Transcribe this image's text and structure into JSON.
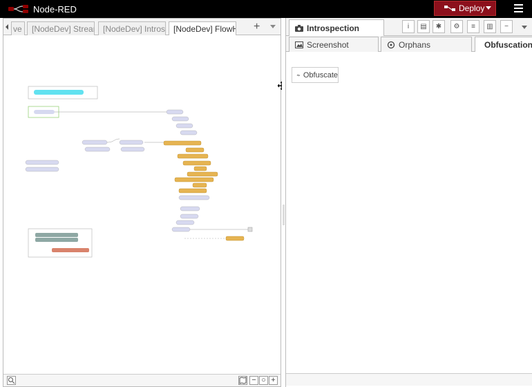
{
  "header": {
    "app_title": "Node-RED",
    "deploy_label": "Deploy",
    "colors": {
      "bar": "#000000",
      "deploy": "#8c101c"
    }
  },
  "workspace": {
    "tabs": [
      {
        "label": "ve"
      },
      {
        "label": "[NodeDev] Streamli"
      },
      {
        "label": "[NodeDev] Introspe"
      },
      {
        "label": "[NodeDev] FlowHu"
      }
    ],
    "add_label": "+",
    "footer": {
      "zoom_out": "−",
      "zoom_reset": "○",
      "zoom_in": "+"
    }
  },
  "sidebar": {
    "active_tab": "Introspection",
    "tools": [
      "info-icon",
      "book-icon",
      "bug-icon",
      "gear-icon",
      "database-icon",
      "chart-icon",
      "minus-icon"
    ],
    "subtabs": [
      {
        "label": "Screenshot",
        "icon": "image-icon"
      },
      {
        "label": "Orphans",
        "icon": "crosshair-icon"
      },
      {
        "label": "Obfuscation",
        "icon": "lock-icon"
      }
    ],
    "obfuscate_label": "Obfuscate"
  }
}
